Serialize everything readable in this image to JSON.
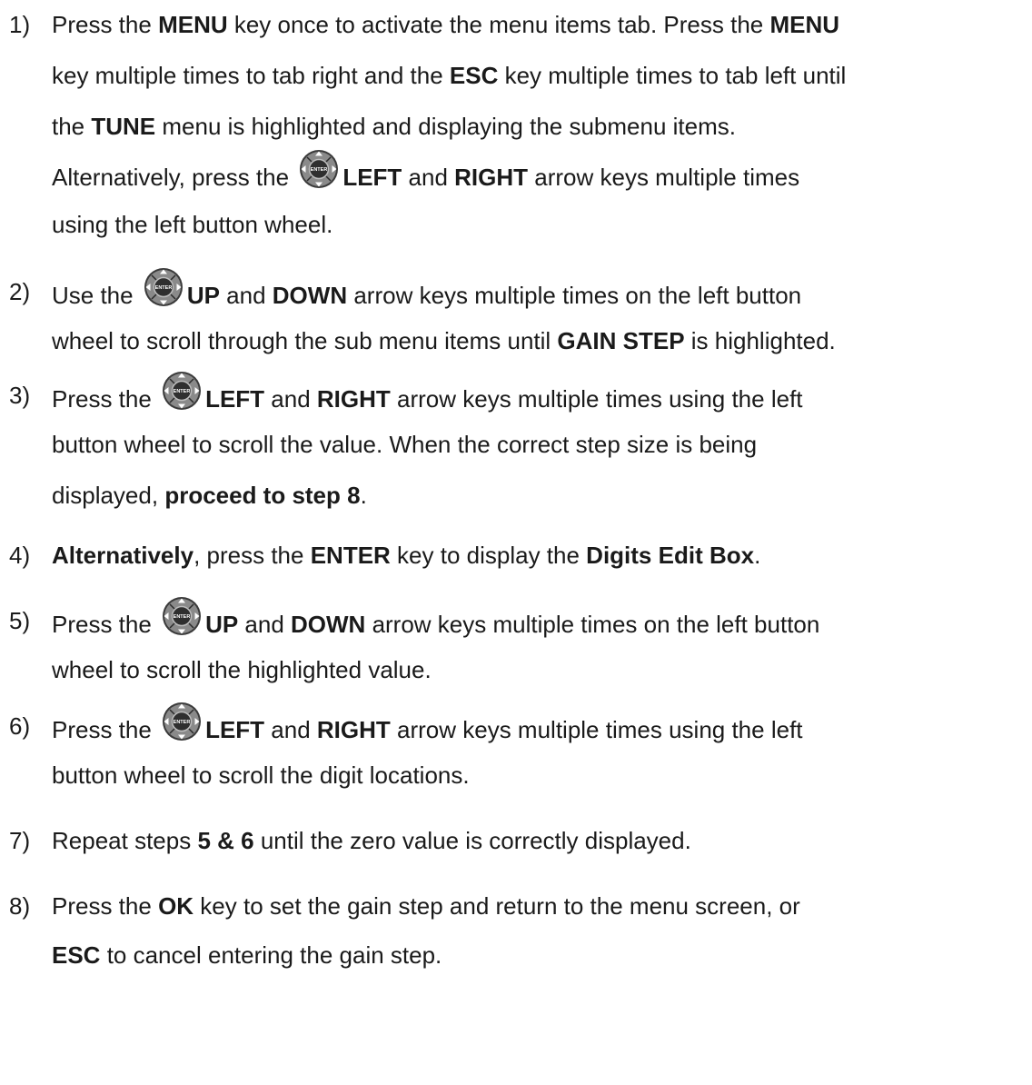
{
  "steps": [
    {
      "num": "1)",
      "lines": [
        [
          {
            "t": "Press the "
          },
          {
            "t": "MENU",
            "b": true
          },
          {
            "t": " key once to activate the menu items tab.  Press the "
          },
          {
            "t": "MENU",
            "b": true
          }
        ],
        [
          {
            "t": "key multiple times to tab right and the "
          },
          {
            "t": "ESC",
            "b": true
          },
          {
            "t": " key multiple times to tab left until"
          }
        ],
        [
          {
            "t": "the "
          },
          {
            "t": "TUNE",
            "b": true
          },
          {
            "t": " menu is highlighted and displaying the submenu items."
          }
        ],
        [
          {
            "t": "Alternatively, press the "
          },
          {
            "icon": "button-wheel-icon"
          },
          {
            "t": "LEFT",
            "b": true
          },
          {
            "t": " and "
          },
          {
            "t": "RIGHT",
            "b": true
          },
          {
            "t": " arrow keys multiple times"
          }
        ],
        [
          {
            "t": "using the left button wheel."
          }
        ]
      ]
    },
    {
      "num": "2)",
      "lines": [
        [
          {
            "t": "Use the "
          },
          {
            "icon": "button-wheel-icon"
          },
          {
            "t": "UP",
            "b": true
          },
          {
            "t": " and "
          },
          {
            "t": "DOWN",
            "b": true
          },
          {
            "t": " arrow keys multiple times on the left button"
          }
        ],
        [
          {
            "t": "wheel to scroll through the sub menu items until "
          },
          {
            "t": "GAIN STEP",
            "b": true
          },
          {
            "t": " is highlighted."
          }
        ]
      ]
    },
    {
      "num": "3)",
      "lines": [
        [
          {
            "t": "Press the "
          },
          {
            "icon": "button-wheel-icon"
          },
          {
            "t": "LEFT",
            "b": true
          },
          {
            "t": " and "
          },
          {
            "t": "RIGHT",
            "b": true
          },
          {
            "t": " arrow keys multiple times using the left"
          }
        ],
        [
          {
            "t": "button wheel to scroll the value.  When the correct step size is being"
          }
        ],
        [
          {
            "t": "displayed, "
          },
          {
            "t": "proceed to step 8",
            "b": true
          },
          {
            "t": "."
          }
        ]
      ]
    },
    {
      "num": "4)",
      "lines": [
        [
          {
            "t": "Alternatively",
            "b": true
          },
          {
            "t": ", press the "
          },
          {
            "t": "ENTER",
            "b": true
          },
          {
            "t": " key to display the "
          },
          {
            "t": "Digits Edit Box",
            "b": true
          },
          {
            "t": "."
          }
        ]
      ]
    },
    {
      "num": "5)",
      "lines": [
        [
          {
            "t": "Press the "
          },
          {
            "icon": "button-wheel-icon"
          },
          {
            "t": "UP",
            "b": true
          },
          {
            "t": " and "
          },
          {
            "t": "DOWN",
            "b": true
          },
          {
            "t": " arrow keys multiple times on the left button"
          }
        ],
        [
          {
            "t": "wheel to scroll the highlighted value."
          }
        ]
      ]
    },
    {
      "num": "6)",
      "lines": [
        [
          {
            "t": "Press the "
          },
          {
            "icon": "button-wheel-icon"
          },
          {
            "t": "LEFT",
            "b": true
          },
          {
            "t": " and "
          },
          {
            "t": "RIGHT",
            "b": true
          },
          {
            "t": " arrow keys multiple times using the left"
          }
        ],
        [
          {
            "t": "button wheel to scroll the digit locations."
          }
        ]
      ]
    },
    {
      "num": "7)",
      "lines": [
        [
          {
            "t": " Repeat steps "
          },
          {
            "t": "5 & 6",
            "b": true
          },
          {
            "t": " until the zero value is correctly displayed."
          }
        ]
      ]
    },
    {
      "num": "8)",
      "lines": [
        [
          {
            "t": "Press the "
          },
          {
            "t": "OK",
            "b": true
          },
          {
            "t": " key to set the gain step and return to the menu screen, or"
          }
        ],
        [
          {
            "t": "ESC",
            "b": true
          },
          {
            "t": " to cancel entering the gain step."
          }
        ]
      ]
    }
  ],
  "wheel_center_label": "ENTER"
}
